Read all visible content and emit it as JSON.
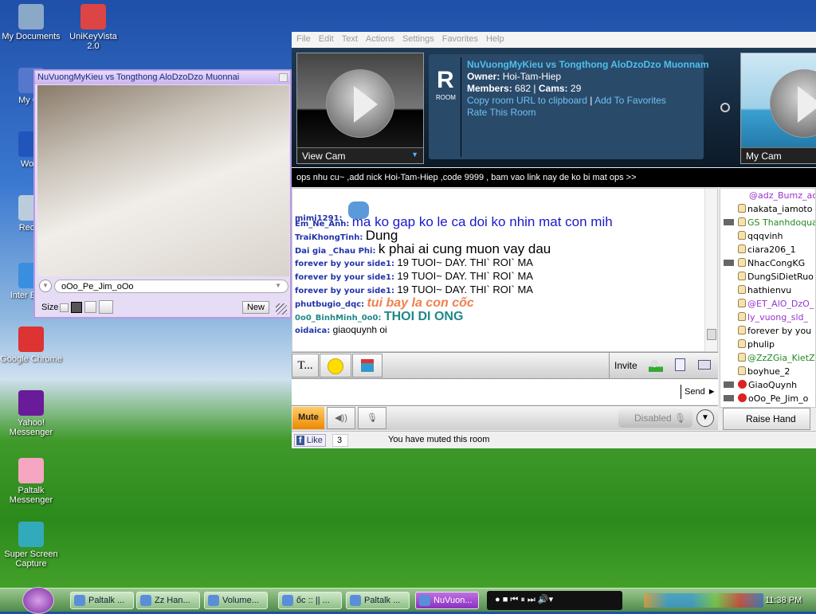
{
  "desktop_icons": [
    {
      "label": "My Documents",
      "icon": "folder-icon",
      "color": "#8aa8c8"
    },
    {
      "label": "My Co",
      "icon": "computer-icon",
      "color": "#5577cc"
    },
    {
      "label": "Word",
      "icon": "word-icon",
      "color": "#2255bb"
    },
    {
      "label": "Recyc",
      "icon": "recycle-bin-icon",
      "color": "#bbccdd"
    },
    {
      "label": "Inter Explo",
      "icon": "ie-icon",
      "color": "#3a8ee0"
    },
    {
      "label": "Google Chrome",
      "icon": "chrome-icon",
      "color": "#d33"
    },
    {
      "label": "Yahoo! Messenger",
      "icon": "yahoo-icon",
      "color": "#6a1b9a"
    },
    {
      "label": "Paltalk Messenger",
      "icon": "paltalk-icon",
      "color": "#f6a6c0"
    },
    {
      "label": "Super Screen Capture",
      "icon": "screen-capture-icon",
      "color": "#3ab"
    },
    {
      "label": "UniKeyVista 2.0",
      "icon": "unikey-icon",
      "color": "#d44"
    }
  ],
  "cam_window": {
    "title": "NuVuongMyKieu vs Tongthong AloDzoDzo Muonnai",
    "user": "oOo_Pe_Jim_oOo",
    "size_label": "Size",
    "new_label": "New"
  },
  "menu": [
    "File",
    "Edit",
    "Text",
    "Actions",
    "Settings",
    "Favorites",
    "Help"
  ],
  "room": {
    "badge": "R",
    "badge_sub": "ROOM",
    "name": "NuVuongMyKieu vs Tongthong AloDzoDzo Muonnam",
    "owner_label": "Owner:",
    "owner": "Hoi-Tam-Hiep",
    "members_label": "Members:",
    "members": "682",
    "cams_label": "Cams:",
    "cams": "29",
    "copy_url": "Copy room URL to clipboard",
    "add_fav": "Add To Favorites",
    "rate": "Rate This Room"
  },
  "view_cam": "View Cam",
  "my_cam": "My Cam",
  "marquee": "ops nhu cu~ ,add nick Hoi-Tam-Hiep ,code 9999 , bam vao link nay de ko bi mat ops >>",
  "chat": [
    {
      "name": "mimi1291:",
      "text": "",
      "color": "#000"
    },
    {
      "name": "Em_Ne_Anh:",
      "text": "ma ko gap ko le ca doi ko nhin mat con mih",
      "color": "#1a1acc"
    },
    {
      "name": "TraiKhongTinh:",
      "text": "Dung",
      "color": "#000"
    },
    {
      "name": "Dai gia _Chau Phi:",
      "text": "k phai ai cung muon vay dau",
      "color": "#000"
    },
    {
      "name": "forever by your side1:",
      "text": "19 TUOI~ DAY. THI` ROI` MA",
      "color": "#000"
    },
    {
      "name": "forever by your side1:",
      "text": "19 TUOI~ DAY. THI` ROI` MA",
      "color": "#000"
    },
    {
      "name": "forever by your side1:",
      "text": "19 TUOI~ DAY. THI` ROI` MA",
      "color": "#000"
    },
    {
      "name": "phutbugio_dqc:",
      "text": "tui bay la con cốc",
      "color": "#f08050"
    },
    {
      "name": "0o0_BinhMinh_0o0:",
      "text": "THOI DI ONG",
      "color": "#208888"
    },
    {
      "name": "oidaica:",
      "text": "giaoquynh oi",
      "color": "#000"
    }
  ],
  "users": [
    {
      "name": "@adz_Bumz_ac",
      "color": "#9933cc",
      "cam": false,
      "icon": "none"
    },
    {
      "name": "nakata_iamoto",
      "color": "#000",
      "cam": false,
      "icon": "hand"
    },
    {
      "name": "GS Thanhdoqua",
      "color": "#228822",
      "cam": true,
      "icon": "hand"
    },
    {
      "name": "qqqvinh",
      "color": "#000",
      "cam": false,
      "icon": "hand"
    },
    {
      "name": "ciara206_1",
      "color": "#000",
      "cam": false,
      "icon": "hand"
    },
    {
      "name": "NhacCongKG",
      "color": "#000",
      "cam": true,
      "icon": "hand"
    },
    {
      "name": "DungSiDietRuo",
      "color": "#000",
      "cam": false,
      "icon": "hand"
    },
    {
      "name": "hathienvu",
      "color": "#000",
      "cam": false,
      "icon": "hand"
    },
    {
      "name": "@ET_AlO_DzO_",
      "color": "#9933cc",
      "cam": false,
      "icon": "hand"
    },
    {
      "name": "ly_vuong_sld_",
      "color": "#9933cc",
      "cam": false,
      "icon": "hand"
    },
    {
      "name": "forever by you",
      "color": "#000",
      "cam": false,
      "icon": "hand"
    },
    {
      "name": "phulip",
      "color": "#000",
      "cam": false,
      "icon": "hand"
    },
    {
      "name": "@ZzZGia_KietZ",
      "color": "#228822",
      "cam": false,
      "icon": "hand"
    },
    {
      "name": "boyhue_2",
      "color": "#000",
      "cam": false,
      "icon": "hand"
    },
    {
      "name": "GiaoQuynh",
      "color": "#000",
      "cam": true,
      "icon": "block"
    },
    {
      "name": "oOo_Pe_Jim_o",
      "color": "#000",
      "cam": true,
      "icon": "block"
    }
  ],
  "toolbar": {
    "text_btn": "T...",
    "invite": "Invite",
    "send": "Send ►"
  },
  "voice": {
    "mute": "Mute",
    "disabled": "Disabled",
    "raise_hand": "Raise Hand"
  },
  "status": {
    "like": "Like",
    "like_count": "3",
    "message": "You have muted this room"
  },
  "taskbar": {
    "tasks": [
      "Paltalk ...",
      "Zz Han...",
      "Volume...",
      "ốc :: || ...",
      "Paltalk ...",
      "NuVuon..."
    ],
    "clock": "11:38 PM"
  }
}
